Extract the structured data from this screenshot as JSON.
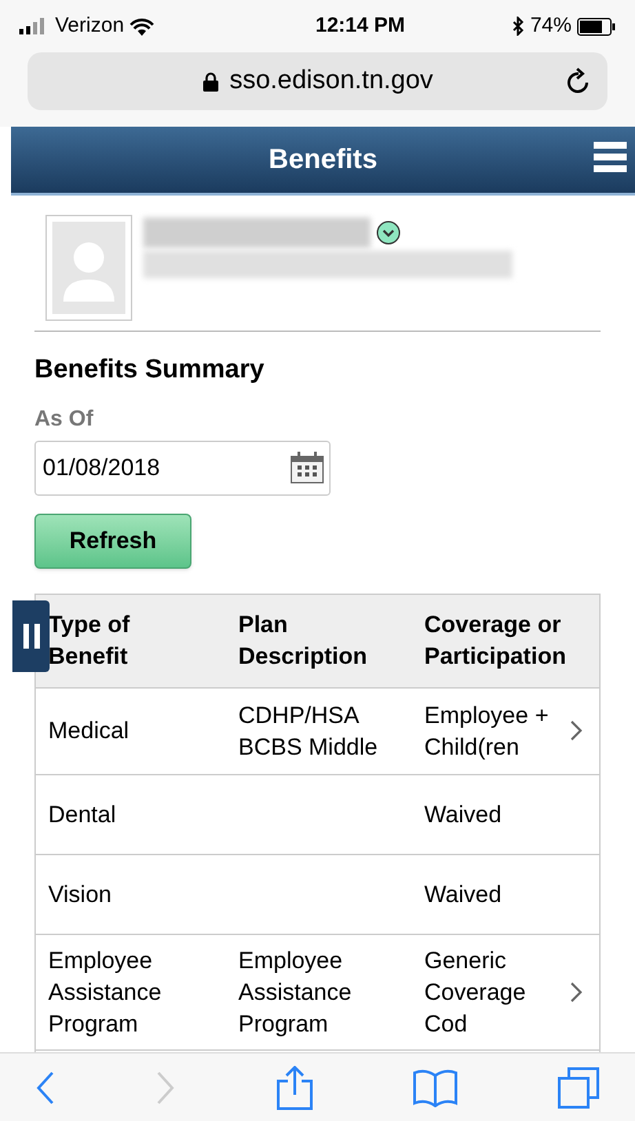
{
  "status_bar": {
    "carrier": "Verizon",
    "time": "12:14 PM",
    "battery": "74%"
  },
  "address_bar": {
    "url": "sso.edison.tn.gov"
  },
  "header": {
    "title": "Benefits"
  },
  "section": {
    "title": "Benefits Summary",
    "as_of_label": "As Of",
    "date_value": "01/08/2018",
    "refresh_button": "Refresh"
  },
  "table": {
    "columns": [
      "Type of Benefit",
      "Plan Description",
      "Coverage or Participation"
    ],
    "rows": [
      {
        "type": "Medical",
        "plan": "CDHP/HSA BCBS Middle",
        "coverage": "Employee + Child(ren",
        "has_detail": true
      },
      {
        "type": "Dental",
        "plan": "",
        "coverage": "Waived",
        "has_detail": false
      },
      {
        "type": "Vision",
        "plan": "",
        "coverage": "Waived",
        "has_detail": false
      },
      {
        "type": "Employee Assistance Program",
        "plan": "Employee Assistance Program",
        "coverage": "Generic Coverage Cod",
        "has_detail": true
      }
    ]
  },
  "browser_toolbar": {
    "back_disabled": false,
    "forward_disabled": true
  }
}
